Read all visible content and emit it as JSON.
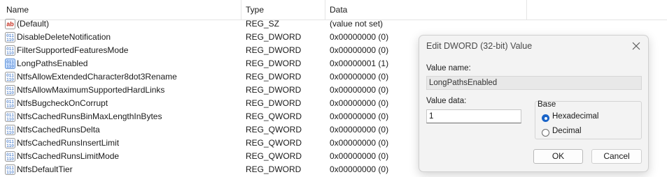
{
  "columns": {
    "name": "Name",
    "type": "Type",
    "data": "Data"
  },
  "rows": [
    {
      "icon": "string-value-icon",
      "name": "(Default)",
      "type": "REG_SZ",
      "data": "(value not set)"
    },
    {
      "icon": "binary-value-icon",
      "name": "DisableDeleteNotification",
      "type": "REG_DWORD",
      "data": "0x00000000 (0)"
    },
    {
      "icon": "binary-value-icon",
      "name": "FilterSupportedFeaturesMode",
      "type": "REG_DWORD",
      "data": "0x00000000 (0)"
    },
    {
      "icon": "binary-value-icon",
      "name": "LongPathsEnabled",
      "type": "REG_DWORD",
      "data": "0x00000001 (1)",
      "selected": true
    },
    {
      "icon": "binary-value-icon",
      "name": "NtfsAllowExtendedCharacter8dot3Rename",
      "type": "REG_DWORD",
      "data": "0x00000000 (0)"
    },
    {
      "icon": "binary-value-icon",
      "name": "NtfsAllowMaximumSupportedHardLinks",
      "type": "REG_DWORD",
      "data": "0x00000000 (0)"
    },
    {
      "icon": "binary-value-icon",
      "name": "NtfsBugcheckOnCorrupt",
      "type": "REG_DWORD",
      "data": "0x00000000 (0)"
    },
    {
      "icon": "binary-value-icon",
      "name": "NtfsCachedRunsBinMaxLengthInBytes",
      "type": "REG_QWORD",
      "data": "0x00000000 (0)"
    },
    {
      "icon": "binary-value-icon",
      "name": "NtfsCachedRunsDelta",
      "type": "REG_QWORD",
      "data": "0x00000000 (0)"
    },
    {
      "icon": "binary-value-icon",
      "name": "NtfsCachedRunsInsertLimit",
      "type": "REG_QWORD",
      "data": "0x00000000 (0)"
    },
    {
      "icon": "binary-value-icon",
      "name": "NtfsCachedRunsLimitMode",
      "type": "REG_QWORD",
      "data": "0x00000000 (0)"
    },
    {
      "icon": "binary-value-icon",
      "name": "NtfsDefaultTier",
      "type": "REG_DWORD",
      "data": "0x00000000 (0)"
    }
  ],
  "dialog": {
    "title": "Edit DWORD (32-bit) Value",
    "close_icon": "close-icon",
    "value_name_label": "Value name:",
    "value_name": "LongPathsEnabled",
    "value_data_label": "Value data:",
    "value_data": "1",
    "base_label": "Base",
    "base_options": [
      "Hexadecimal",
      "Decimal"
    ],
    "base_selected": "Hexadecimal",
    "ok_label": "OK",
    "cancel_label": "Cancel"
  },
  "colors": {
    "accent": "#1a64c8",
    "selected_row": "#cce8ff",
    "string_icon_red": "#c42b1c",
    "binary_icon_blue": "#1f5fbf"
  }
}
